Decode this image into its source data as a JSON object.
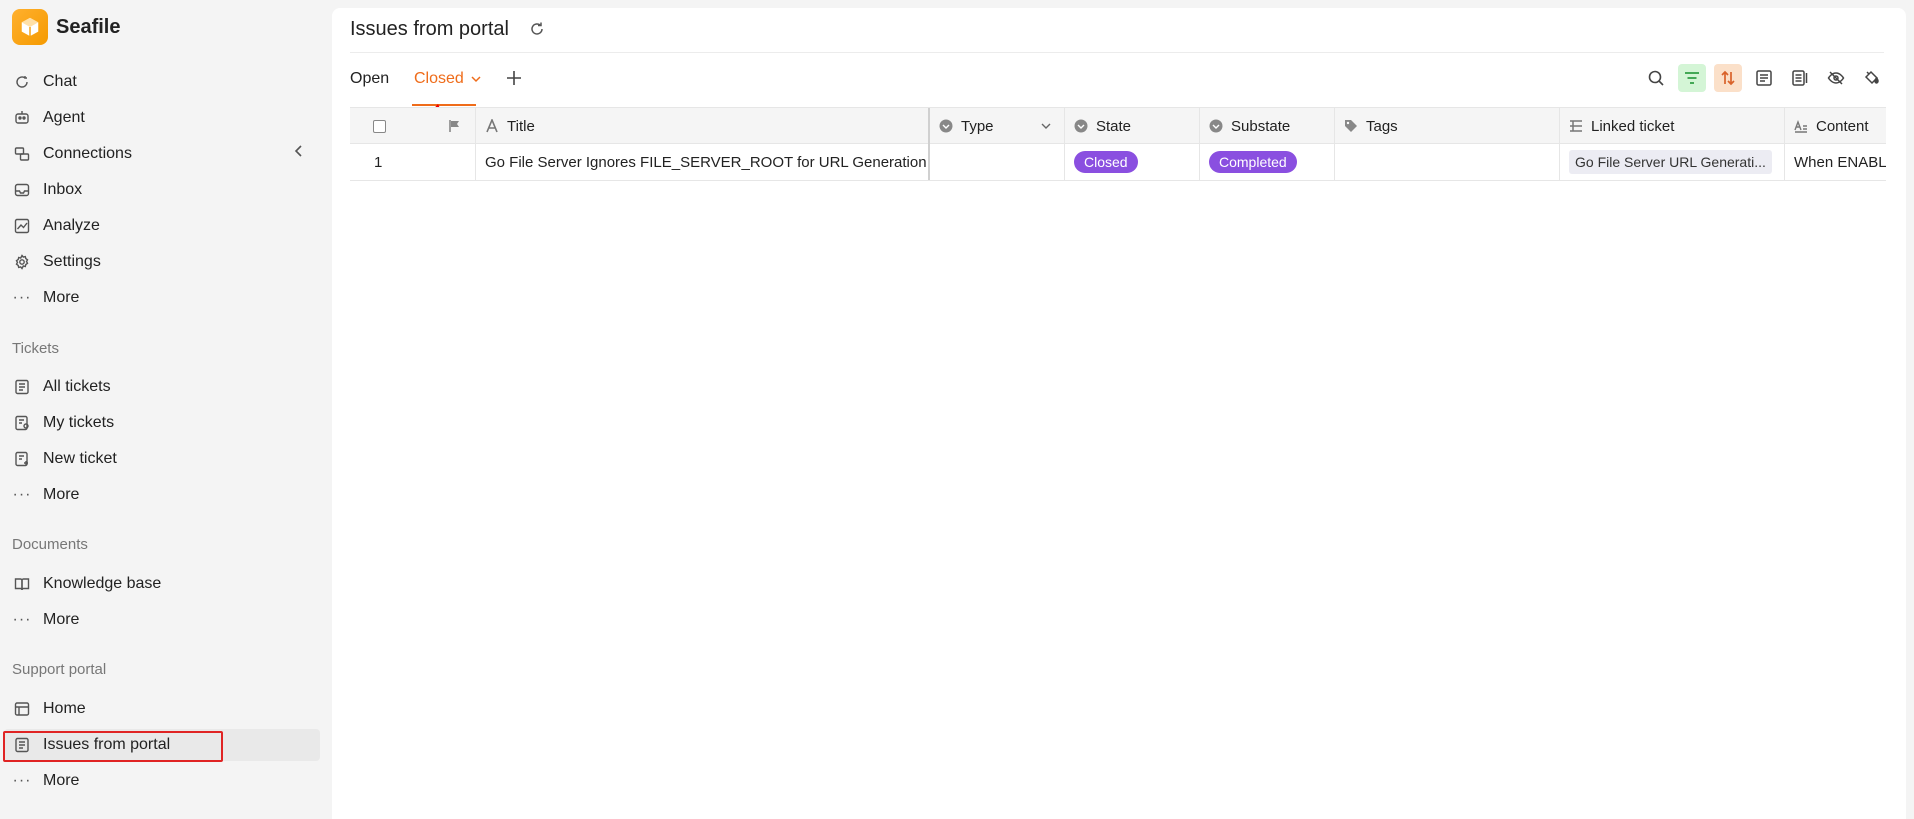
{
  "app": {
    "name": "Seafile"
  },
  "sidebar": {
    "primary": [
      {
        "label": "Chat",
        "icon": "chat-icon"
      },
      {
        "label": "Agent",
        "icon": "robot-icon"
      },
      {
        "label": "Connections",
        "icon": "connections-icon"
      },
      {
        "label": "Inbox",
        "icon": "inbox-icon"
      },
      {
        "label": "Analyze",
        "icon": "chart-icon"
      },
      {
        "label": "Settings",
        "icon": "gear-icon"
      },
      {
        "label": "More",
        "icon": "ellipsis-icon"
      }
    ],
    "tickets": {
      "label": "Tickets",
      "items": [
        {
          "label": "All tickets",
          "icon": "list-icon"
        },
        {
          "label": "My tickets",
          "icon": "user-list-icon"
        },
        {
          "label": "New ticket",
          "icon": "new-ticket-icon"
        },
        {
          "label": "More",
          "icon": "ellipsis-icon"
        }
      ]
    },
    "documents": {
      "label": "Documents",
      "items": [
        {
          "label": "Knowledge base",
          "icon": "book-icon"
        },
        {
          "label": "More",
          "icon": "ellipsis-icon"
        }
      ]
    },
    "support_portal": {
      "label": "Support portal",
      "items": [
        {
          "label": "Home",
          "icon": "home-icon"
        },
        {
          "label": "Issues from portal",
          "icon": "list-icon"
        },
        {
          "label": "More",
          "icon": "ellipsis-icon"
        }
      ]
    }
  },
  "main": {
    "title": "Issues from portal",
    "tabs": [
      {
        "label": "Open"
      },
      {
        "label": "Closed"
      }
    ],
    "table": {
      "columns": [
        "Title",
        "Type",
        "State",
        "Substate",
        "Tags",
        "Linked ticket",
        "Content"
      ],
      "rows": [
        {
          "index": "1",
          "title": "Go File Server Ignores FILE_SERVER_ROOT for URL Generation",
          "type": "",
          "state": "Closed",
          "substate": "Completed",
          "tags": "",
          "linked_ticket": "Go File Server URL Generati...",
          "content": "When ENABLE"
        }
      ]
    }
  },
  "colors": {
    "accent": "#ef6c1a",
    "pill": "#8a4fe0",
    "brand": "#ffa500"
  }
}
